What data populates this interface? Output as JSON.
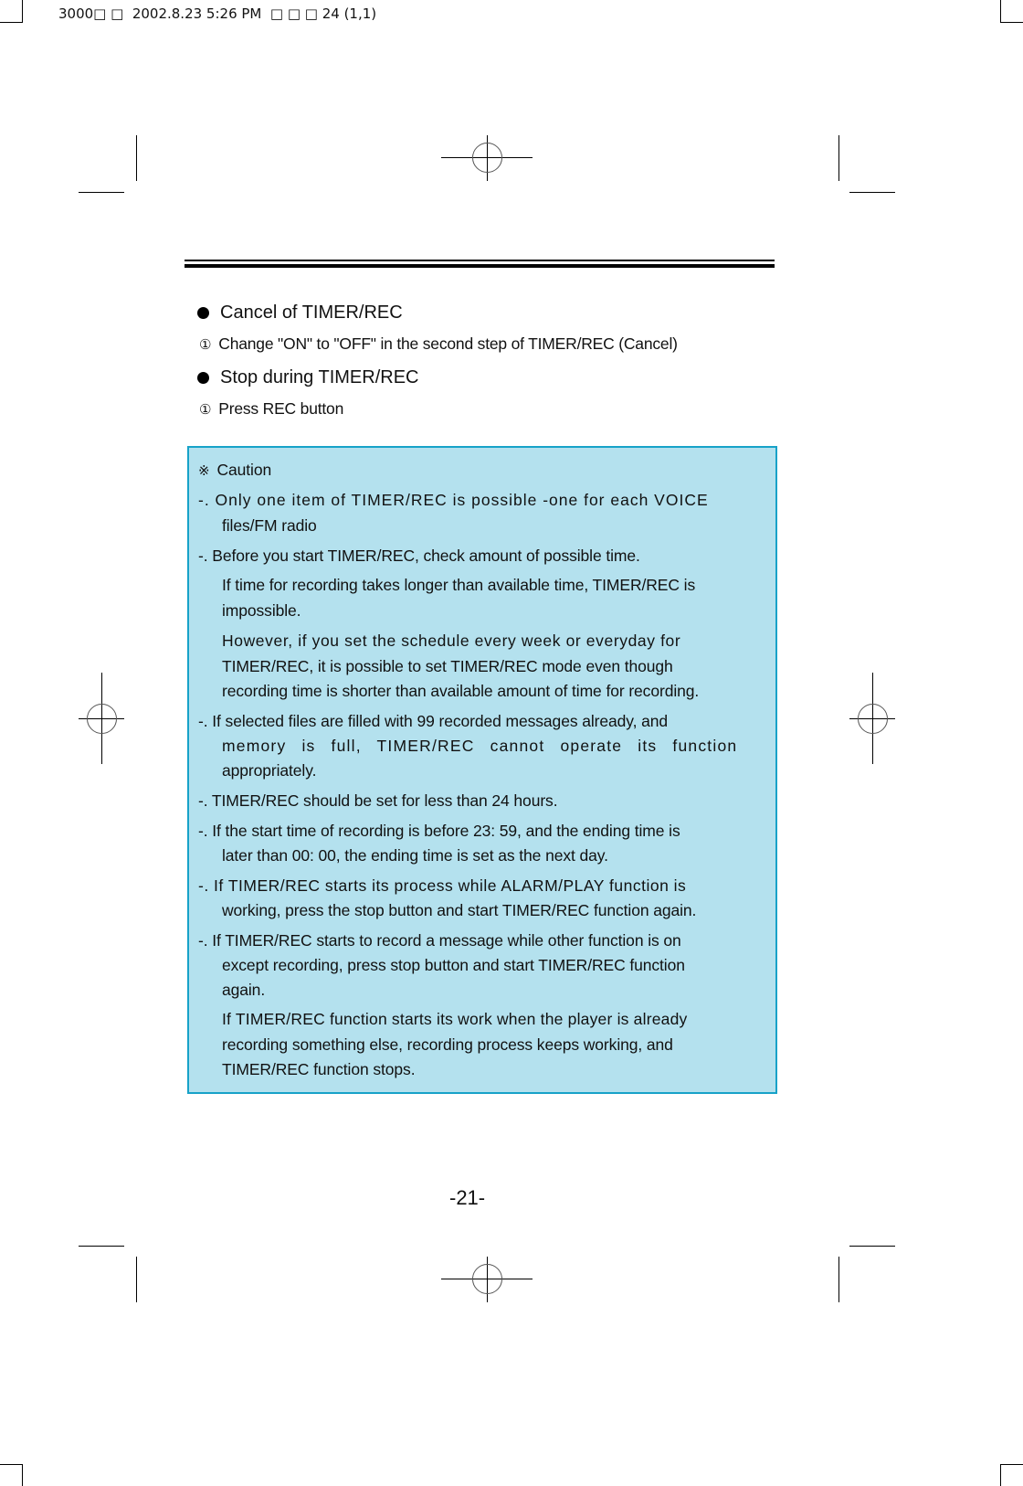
{
  "slug": {
    "text": "3000□ □  2002.8.23 5:26 PM  □ □ □ 24 (1,1)"
  },
  "sections": [
    {
      "heading": "Cancel of TIMER/REC",
      "steps": [
        {
          "num": "①",
          "text": "Change \"ON\" to \"OFF\" in the second step of TIMER/REC (Cancel)"
        }
      ]
    },
    {
      "heading": "Stop during TIMER/REC",
      "steps": [
        {
          "num": "①",
          "text": "Press REC button"
        }
      ]
    }
  ],
  "caution": {
    "title_symbol": "※",
    "title": "Caution",
    "lines": [
      "-. Only one item of TIMER/REC is possible -one for each VOICE",
      "files/FM radio",
      "-. Before you start TIMER/REC, check amount of possible time.",
      "If time for recording takes longer than available time, TIMER/REC is",
      "impossible.",
      "However, if you set the schedule every week or everyday for",
      "TIMER/REC, it is possible to set TIMER/REC mode even though",
      "recording time is shorter than available amount of time for recording.",
      "-. If selected files are filled with 99 recorded messages already, and",
      "memory is full, TIMER/REC cannot operate its function",
      "appropriately.",
      "-. TIMER/REC should be set for less than 24 hours.",
      "-. If the start time of recording is before 23: 59, and the ending time is",
      "later than 00: 00, the ending time is set as the next day.",
      "-. If TIMER/REC starts its process while ALARM/PLAY function is",
      "working, press the stop button and start TIMER/REC function again.",
      "-. If TIMER/REC starts to record a message while other function is on",
      "except recording, press stop button and start TIMER/REC function",
      "again.",
      "If TIMER/REC function starts its work when the player is already",
      "recording something else, recording process keeps working, and",
      "TIMER/REC function stops."
    ]
  },
  "page_number": "-21-"
}
